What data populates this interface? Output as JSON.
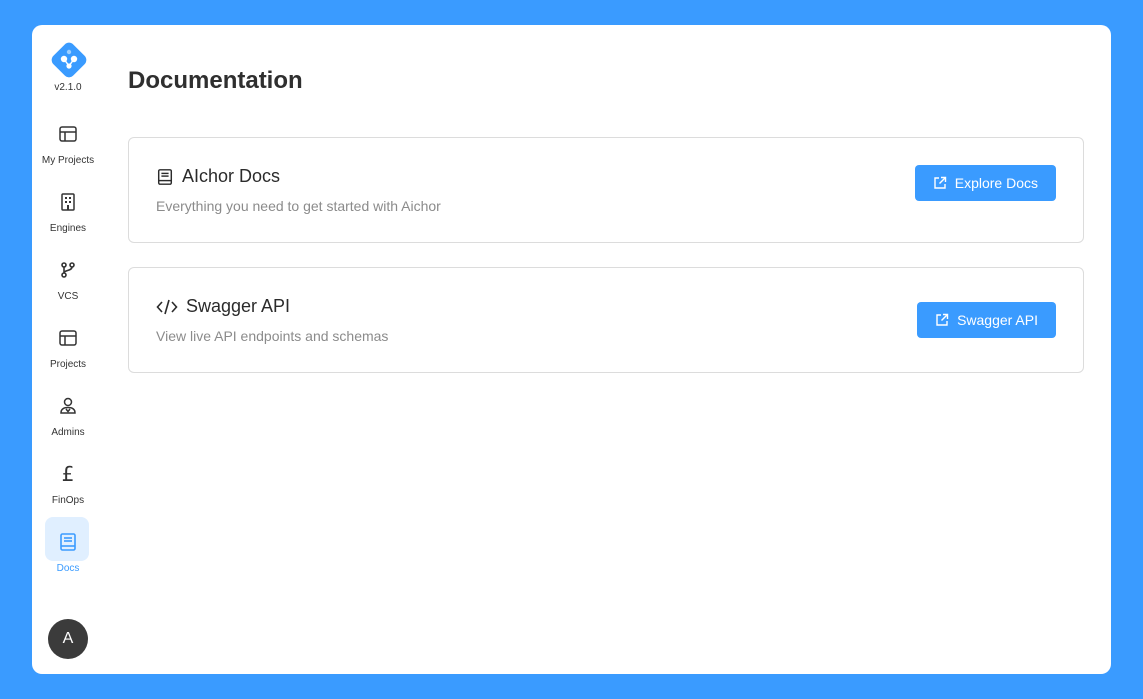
{
  "app": {
    "version": "v2.1.0",
    "accent_color": "#3a9bff",
    "logo_icon": "molecule-logo-icon"
  },
  "sidebar": {
    "items": [
      {
        "label": "My Projects",
        "icon": "layout-icon",
        "active": false
      },
      {
        "label": "Engines",
        "icon": "building-icon",
        "active": false
      },
      {
        "label": "VCS",
        "icon": "git-branch-icon",
        "active": false
      },
      {
        "label": "Projects",
        "icon": "layout-icon",
        "active": false
      },
      {
        "label": "Admins",
        "icon": "user-admin-icon",
        "active": false
      },
      {
        "label": "FinOps",
        "icon": "pound-icon",
        "active": false
      },
      {
        "label": "Docs",
        "icon": "book-icon",
        "active": true
      }
    ],
    "avatar_initial": "A"
  },
  "main": {
    "title": "Documentation",
    "cards": [
      {
        "title": "AIchor Docs",
        "description": "Everything you need to get started with Aichor",
        "icon": "book-icon",
        "button_label": "Explore Docs",
        "button_icon": "external-link-icon"
      },
      {
        "title": "Swagger API",
        "description": "View live API endpoints and schemas",
        "icon": "code-icon",
        "button_label": "Swagger API",
        "button_icon": "external-link-icon"
      }
    ]
  }
}
